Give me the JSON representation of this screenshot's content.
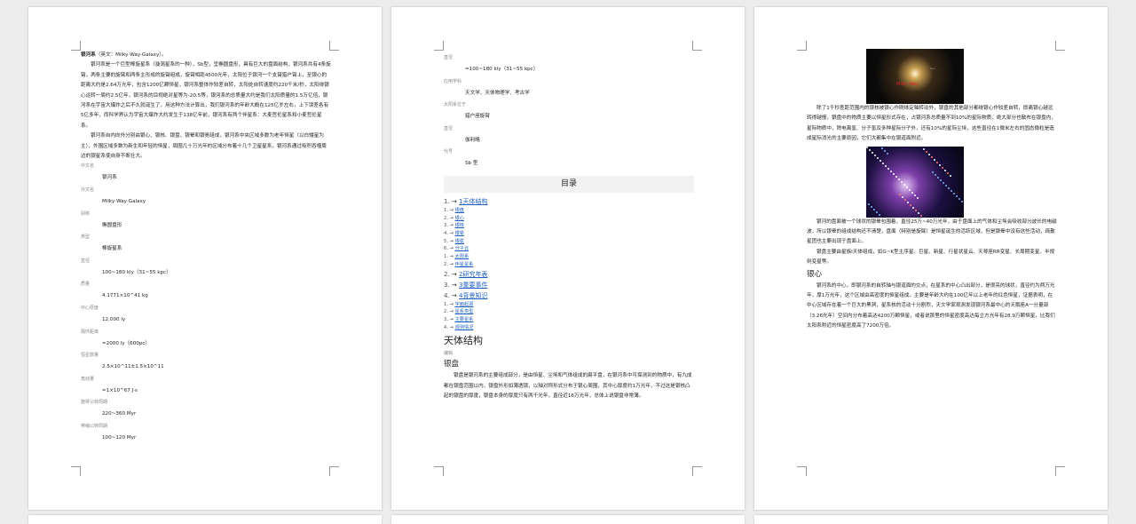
{
  "page1": {
    "p1_title": "银河系",
    "p1_title_rest": "（英文：Milky·Way·Galaxy）。",
    "p1_para1": "银河系是一个巨型棒旋星系（漩涡星系的一种），Sb型，呈椭圆盘形，具有巨大的盘面结构，银河系共有4条旋臂，两条主要的旋臂和两条主形成的旋臂组成，旋臂相距4500光年，太阳位于银河一个支臂猎户臂上，至银心的距离大约是2.64万光年，包含1200亿颗恒星，银河系整体作较差自转，太阳处自转速度约220千米/秒，太阳绕银心运转一周约2.5亿年，银河系的目视绝对星等为-20.5等，银河系的总质量大约是我们太阳质量的1.5万亿倍，银河系在宇宙大爆炸之后不久就诞生了，用这种方法计算出，我们银河系的年龄大概在125亿岁左右，上下误差各有5亿多年，而科学界认为宇宙大爆炸大约发生于138亿年前，银河系有两个伴星系：大麦哲伦星系和小麦哲伦星系。",
    "p1_para2": "银河系自内向外分别由银心、银核、银盘、银晕和银冕组成，银河系中央区域多数为老年恒星（以白矮星为主），外围区域多数为新生和年轻的恒星，周围几十万光年的区域分布着十几个卫星星系，银河系通过吸积吞噬周边的银星系使自身不断壮大。",
    "fields": [
      {
        "label": "中文名",
        "value": "银河系"
      },
      {
        "label": "外文名",
        "value": "Milky·Way·Galaxy"
      },
      {
        "label": "别称",
        "value": "椭圆盘形"
      },
      {
        "label": "类型",
        "value": "棒旋星系"
      },
      {
        "label": "直径",
        "value": "100~180 kly（31~55 kpc）"
      },
      {
        "label": "质量",
        "value": "4.1771×10^41 kg"
      },
      {
        "label": "中心厚度",
        "value": "12,000 ly"
      },
      {
        "label": "隔环距离",
        "value": "≈2000 ly（600pc）"
      },
      {
        "label": "恒星数量",
        "value": "2.5×10^11±1.5×10^11"
      },
      {
        "label": "角动量",
        "value": "≈1×10^67 J·s"
      },
      {
        "label": "旋臂公转周期",
        "value": "220~360 Myr"
      },
      {
        "label": "棒缩公转周期",
        "value": "100~120 Myr"
      }
    ]
  },
  "page2": {
    "fields": [
      {
        "label": "直径",
        "value": "≈100~180 kly（31~55 kpc）"
      },
      {
        "label": "应用学科",
        "value": "天文学、天体物理学、考古学"
      },
      {
        "label": "太阳系位于",
        "value": "猎户座旋臂"
      },
      {
        "label": "直径",
        "value": "伽利略"
      },
      {
        "label": "代号",
        "value": "Sb 型"
      }
    ],
    "toc_title": "目录",
    "toc": [
      {
        "num": "1",
        "text": "1天体结构",
        "big": true
      },
      {
        "num": "1",
        "text": "银盘",
        "big": false
      },
      {
        "num": "2",
        "text": "银心",
        "big": false
      },
      {
        "num": "3",
        "text": "银核",
        "big": false
      },
      {
        "num": "4",
        "text": "银晕",
        "big": false
      },
      {
        "num": "5",
        "text": "银冕",
        "big": false
      },
      {
        "num": "6",
        "text": "分子云",
        "big": false
      },
      {
        "num": "1",
        "text": "太阳系",
        "big": false
      },
      {
        "num": "2",
        "text": "伴星星系",
        "big": false
      },
      {
        "num": "2",
        "text": "2研究年表",
        "big": true
      },
      {
        "num": "3",
        "text": "3重要事件",
        "big": true
      },
      {
        "num": "4",
        "text": "4背景知识",
        "big": true
      },
      {
        "num": "1",
        "text": "字面起源",
        "big": false
      },
      {
        "num": "2",
        "text": "星系类型",
        "big": false
      },
      {
        "num": "3",
        "text": "主要星系",
        "big": false
      },
      {
        "num": "4",
        "text": "观测情况",
        "big": false
      }
    ],
    "heading1": "天体结构",
    "note": "编辑",
    "heading2": "银盘",
    "para": "银盘是银河系的主要组成部分，是由恒星、尘埃和气体组成的扁平盘，在银河系中可探测到的物质中，有九成都在银盘范围以内，银盘外形如薄透镜，以轴对称形式分布于银心周围，其中心厚度约1万光年，不过这是银核凸起的银盘的厚度，银盘本身的厚度只有两千光年，直径近16万光年，总体上说银盘非常薄。"
  },
  "page3": {
    "img1_caption": "Milky Way",
    "img1_tag": "Sun",
    "para1": "除了1千秒差距范围内的银核被银心作刚体定轴转动外，银盘的其他部分都绕银心作较差自转，即离银心越远转得越慢，银盘中的物质主要以恒星形式存在，占银河系总质量不到10%的星际物质，绝大部分也散布在银盘内，星际物质中，除电离氢、分子氢及多种星际分子外，还有10%的星际尘埃，这些直径在1微米左右的固态微粒是造成星际消光的主要原因，它们大都集中在银道面附近。",
    "para2": "银河的盘面被一个球状的银晕包围着，直径25万~40万光年，由于盘面上的气体和尘埃会吸收部分波长的电磁波，所以银晕的组成结构还不清楚，盘面（特别是旋臂）是恒星诞生的活跃区域，但是银晕中没有这些活动，疏散星团也主要出现于盘面上。",
    "para3": "银盘主要由星族Ⅰ天体组成，如G~K型主序星、巨星、新星、行星状星云、天琴座RR变星、长周期变星、半规则变星等。",
    "heading2": "银心",
    "para4": "银河系的中心，即银河系的自转轴与银道面的交点，在星系的中心凸出部分，是很亮的球状，直径约为两万光年，厚1万光年，这个区域由高密度的恒星组成，主要是年龄大约在100亿年以上老年的红色恒星，证据表明，在中心区域存在着一个巨大的黑洞，星系核的活动十分剧烈，天文学家观测发现银河系最中心的天鹅座A一分量部（3.26光年）空间内分布着高达4200万颗恒星，或者说那里的恒星密度高达每立方光年有28.9万颗恒星，比我们太阳系附近的恒星密度高了7200万倍。"
  }
}
